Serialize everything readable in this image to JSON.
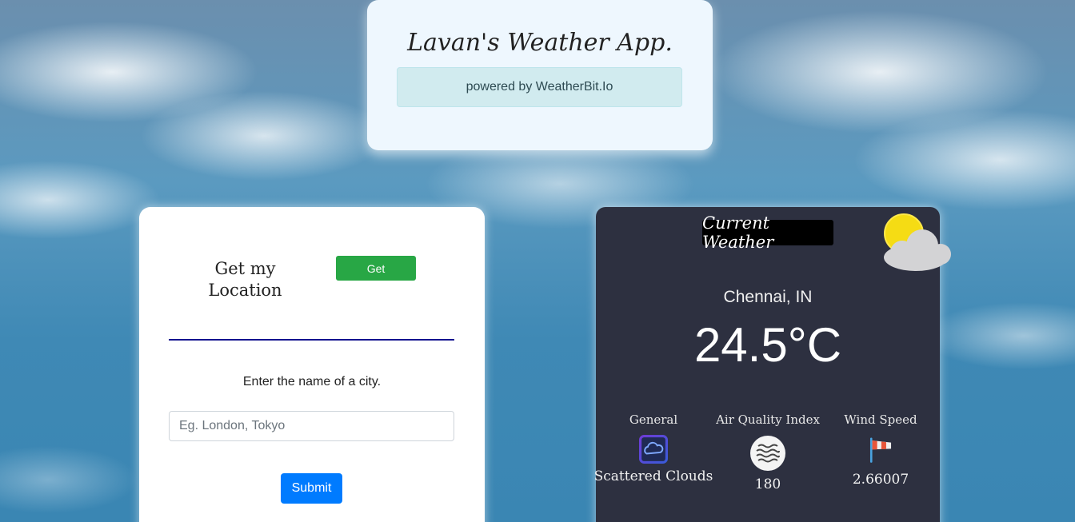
{
  "header": {
    "title": "Lavan's Weather App.",
    "powered_by": "powered by WeatherBit.Io"
  },
  "location_panel": {
    "heading": "Get my Location",
    "get_button_label": "Get",
    "city_prompt": "Enter the name of a city.",
    "city_input_placeholder": "Eg. London, Tokyo",
    "city_input_value": "",
    "submit_label": "Submit"
  },
  "weather_panel": {
    "title": "Current Weather",
    "weather_icon": "sun-behind-cloud-icon",
    "city": "Chennai, IN",
    "temperature": "24.5°C",
    "stats": [
      {
        "label": "General",
        "icon": "cloud-app-icon",
        "value": "Scattered Clouds"
      },
      {
        "label": "Air Quality Index",
        "icon": "haze-icon",
        "value": "180"
      },
      {
        "label": "Wind Speed",
        "icon": "windsock-icon",
        "value": "2.66007"
      }
    ]
  },
  "colors": {
    "get_button": "#28a745",
    "submit_button": "#007bff",
    "divider": "#12128f",
    "weather_card_bg": "#2d3040",
    "header_card_bg": "#eef7fe",
    "powered_box_bg": "#d1ebef"
  }
}
